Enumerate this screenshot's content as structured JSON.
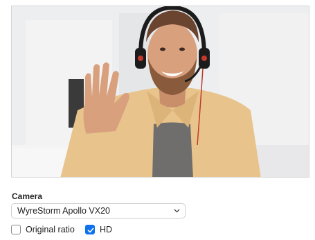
{
  "camera_section": {
    "label": "Camera",
    "selected_device": "WyreStorm Apollo VX20"
  },
  "options": {
    "original_ratio": {
      "label": "Original ratio",
      "checked": false
    },
    "hd": {
      "label": "HD",
      "checked": true
    }
  },
  "colors": {
    "accent": "#0e72ed"
  },
  "icons": {
    "dropdown": "chevron-down-icon",
    "check": "checkmark-icon"
  }
}
